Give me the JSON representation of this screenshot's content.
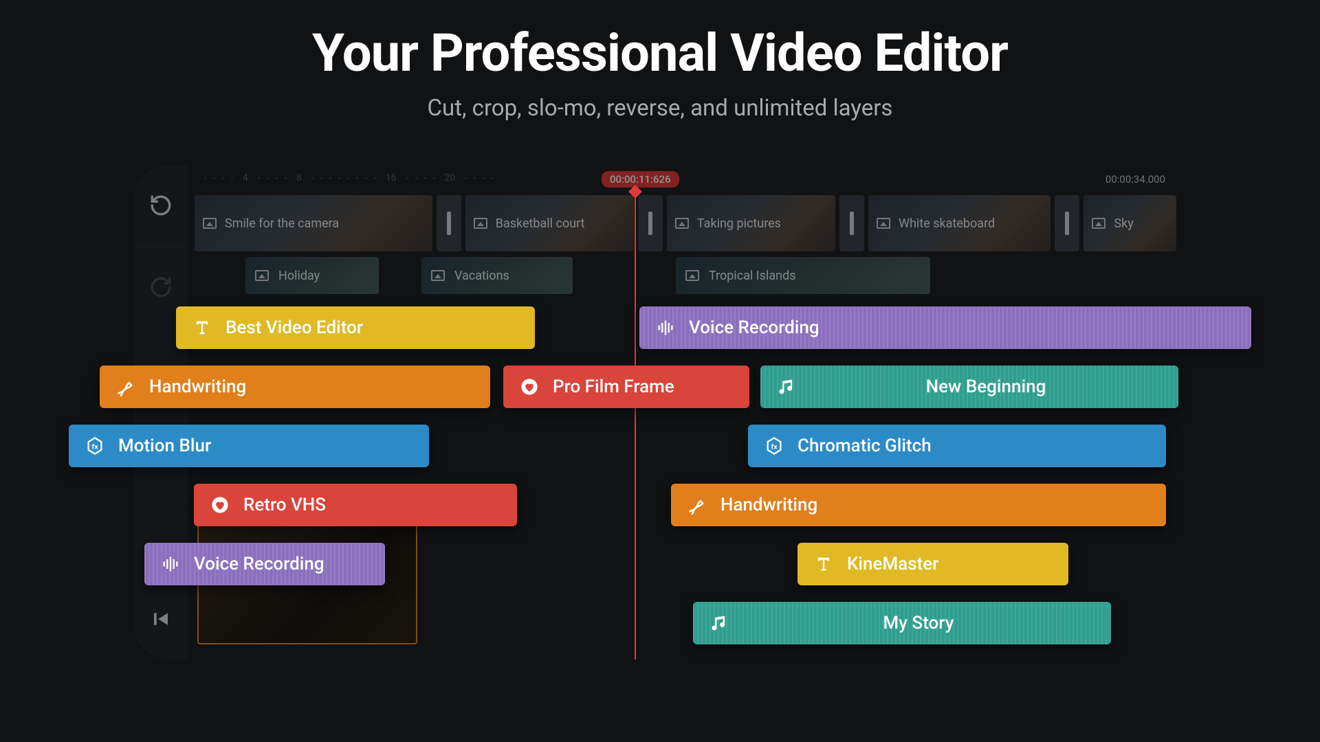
{
  "hero": {
    "title": "Your Professional Video Editor",
    "subtitle": "Cut, crop, slo-mo, reverse, and unlimited layers"
  },
  "timeline": {
    "current_time": "00:00:11:626",
    "total_time": "00:00:34.000",
    "ruler_marks": [
      "4",
      "8",
      "16",
      "20"
    ],
    "clips": [
      {
        "label": "Smile for the camera"
      },
      {
        "label": "Basketball court"
      },
      {
        "label": "Taking pictures"
      },
      {
        "label": "White skateboard"
      },
      {
        "label": "Sky"
      }
    ],
    "subclips": [
      {
        "label": "Holiday"
      },
      {
        "label": "Vacations"
      },
      {
        "label": "Tropical Islands"
      }
    ]
  },
  "layers": {
    "best_video_editor": "Best Video Editor",
    "voice_recording_1": "Voice Recording",
    "handwriting_1": "Handwriting",
    "pro_film_frame": "Pro Film Frame",
    "new_beginning": "New Beginning",
    "motion_blur": "Motion Blur",
    "chromatic_glitch": "Chromatic Glitch",
    "retro_vhs": "Retro VHS",
    "handwriting_2": "Handwriting",
    "voice_recording_2": "Voice Recording",
    "kinemaster": "KineMaster",
    "my_story": "My Story"
  },
  "icons": {
    "text": "T",
    "audio_bars": "audio",
    "pen": "pen",
    "heart": "heart",
    "fx": "fx",
    "music": "music"
  }
}
